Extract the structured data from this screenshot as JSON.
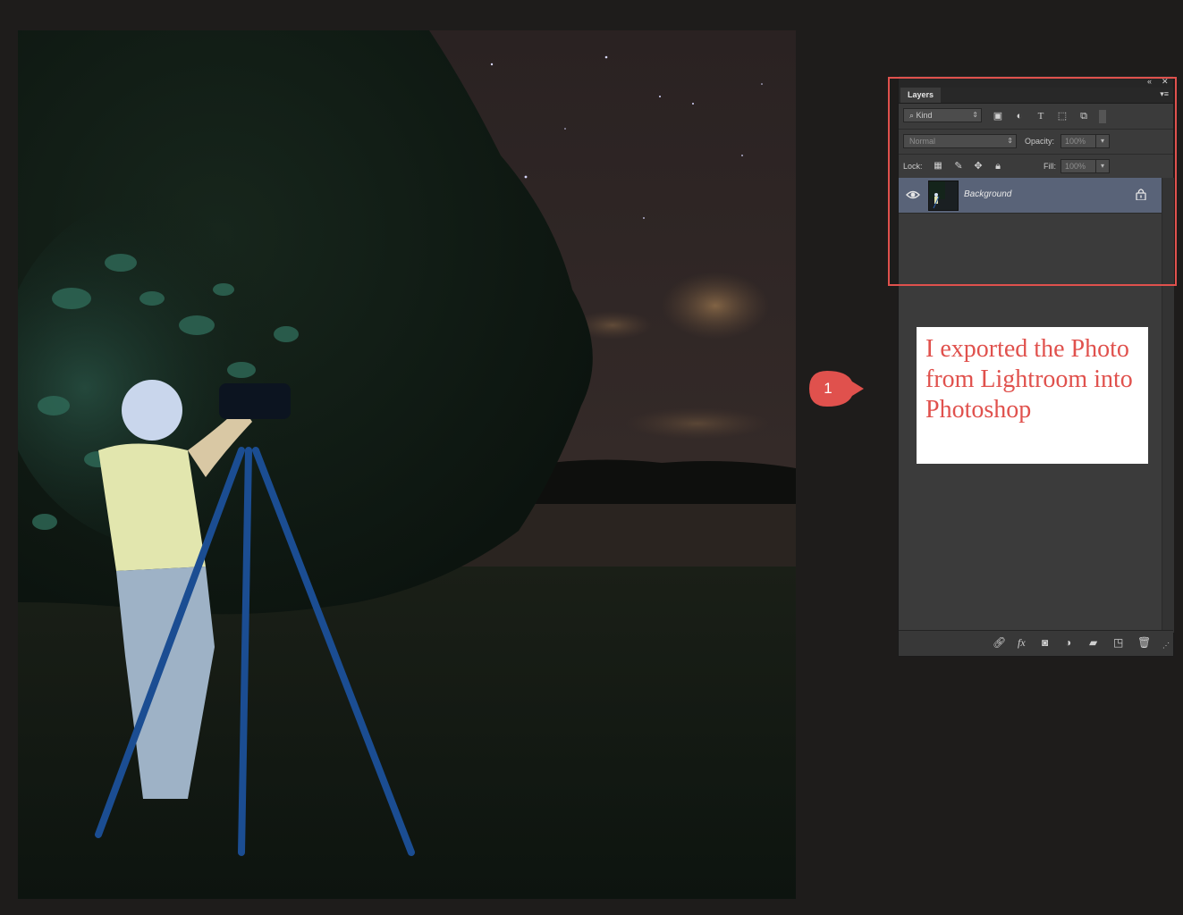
{
  "layers_panel": {
    "tab_label": "Layers",
    "filter_kind": "Kind",
    "blend_mode": "Normal",
    "opacity_label": "Opacity:",
    "opacity_value": "100%",
    "lock_label": "Lock:",
    "fill_label": "Fill:",
    "fill_value": "100%",
    "layers": [
      {
        "name": "Background",
        "visible": true,
        "locked": true
      }
    ]
  },
  "callout": {
    "step_number": "1",
    "note": "I exported the Photo from Lightroom into Photoshop",
    "color": "#e0514d"
  },
  "colors": {
    "selected_layer": "#596378",
    "panel_bg": "#3b3b3b",
    "app_bg": "#1e1c1b"
  }
}
